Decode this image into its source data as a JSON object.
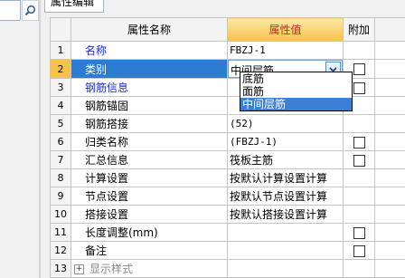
{
  "panel": {
    "title": "属性编辑"
  },
  "grid": {
    "headers": {
      "name": "属性名称",
      "value": "属性值",
      "add": "附加"
    },
    "rows": [
      {
        "num": "1",
        "name": "名称",
        "value": "FBZJ-1",
        "checkbox": false
      },
      {
        "num": "2",
        "name": "类别",
        "value": "中间层筋",
        "checkbox": true
      },
      {
        "num": "3",
        "name": "钢筋信息",
        "value": "",
        "checkbox": true
      },
      {
        "num": "4",
        "name": "钢筋锚固",
        "value": "",
        "checkbox": false
      },
      {
        "num": "5",
        "name": "钢筋搭接",
        "value": "(52)",
        "checkbox": false
      },
      {
        "num": "6",
        "name": "归类名称",
        "value": "(FBZJ-1)",
        "checkbox": true
      },
      {
        "num": "7",
        "name": "汇总信息",
        "value": "筏板主筋",
        "checkbox": true
      },
      {
        "num": "8",
        "name": "计算设置",
        "value": "按默认计算设置计算",
        "checkbox": false
      },
      {
        "num": "9",
        "name": "节点设置",
        "value": "按默认节点设置计算",
        "checkbox": false
      },
      {
        "num": "10",
        "name": "搭接设置",
        "value": "按默认搭接设置计算",
        "checkbox": false
      },
      {
        "num": "11",
        "name": "长度调整(mm)",
        "value": "",
        "checkbox": true
      },
      {
        "num": "12",
        "name": "备注",
        "value": "",
        "checkbox": true
      },
      {
        "num": "13",
        "name": "显示样式",
        "value": "",
        "checkbox": false,
        "expand": "+"
      }
    ]
  },
  "dropdown": {
    "options": [
      "底筋",
      "面筋",
      "中间层筋"
    ],
    "selected": "中间层筋"
  },
  "icons": {
    "search": "search-icon",
    "dropdown_arrow": "chevron-down-icon",
    "expand": "plus-box-icon"
  },
  "colors": {
    "selection": "#2e7bd4",
    "header_highlight": "#f6c24a",
    "link_text": "#1c2bd6"
  }
}
